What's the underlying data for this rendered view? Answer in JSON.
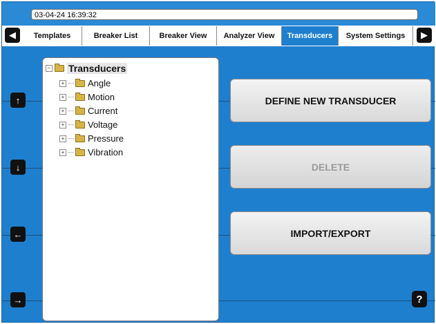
{
  "header": {
    "datetime": "03-04-24 16:39:32"
  },
  "tabs": [
    {
      "label": "Templates",
      "active": false
    },
    {
      "label": "Breaker List",
      "active": false
    },
    {
      "label": "Breaker View",
      "active": false
    },
    {
      "label": "Analyzer View",
      "active": false
    },
    {
      "label": "Transducers",
      "active": true
    },
    {
      "label": "System Settings",
      "active": false
    }
  ],
  "tree": {
    "root": "Transducers",
    "items": [
      {
        "label": "Angle"
      },
      {
        "label": "Motion"
      },
      {
        "label": "Current"
      },
      {
        "label": "Voltage"
      },
      {
        "label": "Pressure"
      },
      {
        "label": "Vibration"
      }
    ]
  },
  "actions": {
    "define": "DEFINE NEW TRANSDUCER",
    "delete": "DELETE",
    "import_export": "IMPORT/EXPORT"
  },
  "icons": {
    "left": "◀",
    "right": "▶",
    "up": "↑",
    "down": "↓",
    "back": "←",
    "forward": "→",
    "help": "?"
  },
  "colors": {
    "background": "#1f7fcf",
    "active_tab": "#1f7fcf"
  }
}
